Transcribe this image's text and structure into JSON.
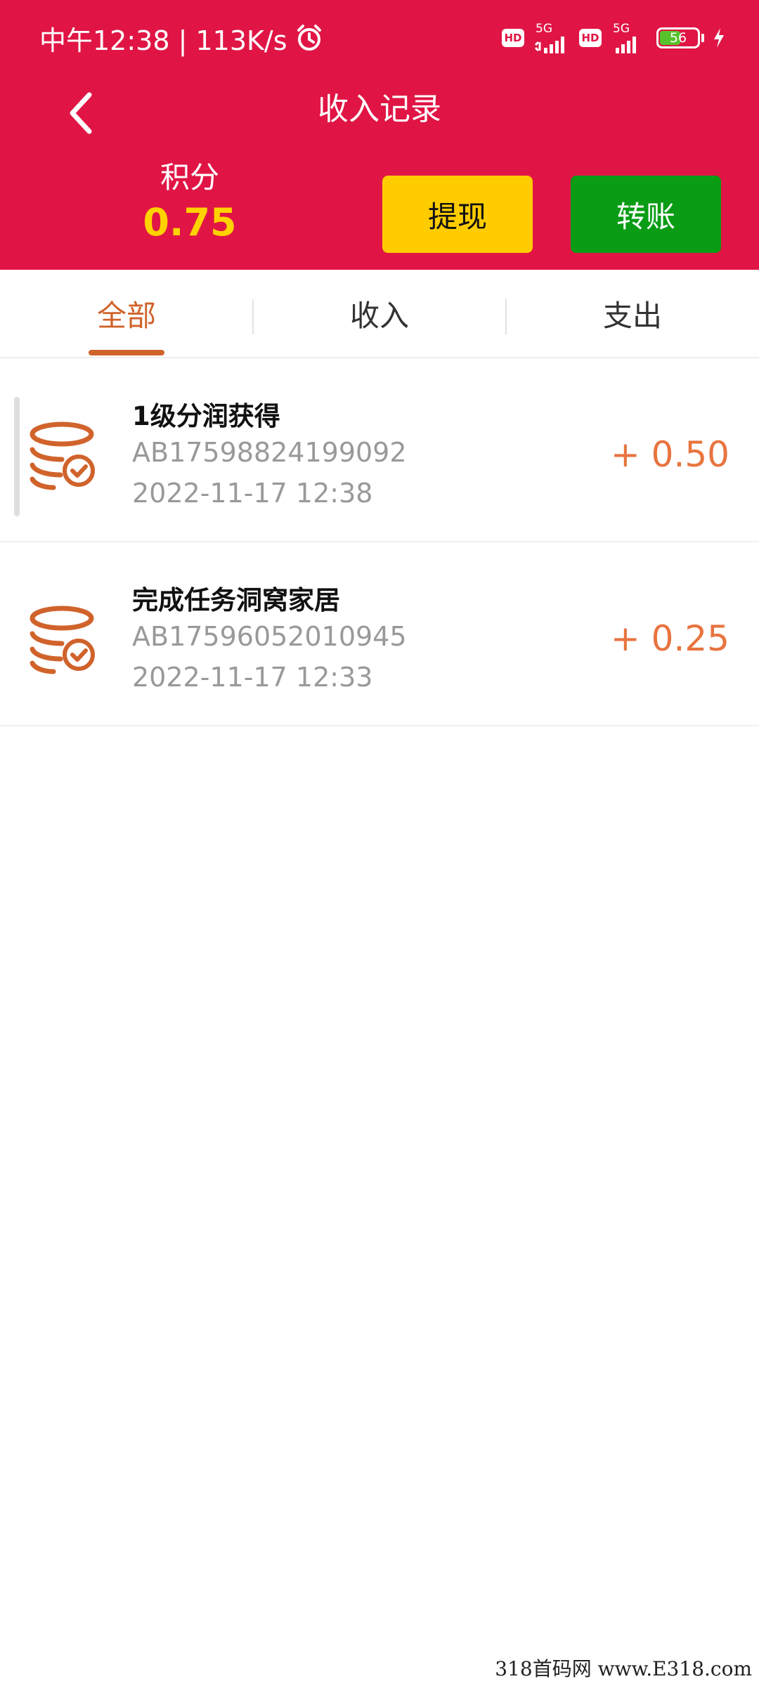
{
  "status_bar": {
    "time_speed": "中午12:38 | 113K/s",
    "hd_label": "HD",
    "network_label": "5G",
    "battery_level": "56",
    "battery_fraction": 0.56,
    "icons": [
      "alarm-clock-icon",
      "signal-icon",
      "battery-icon",
      "charging-icon"
    ]
  },
  "nav": {
    "title": "收入记录",
    "back_icon": "chevron-left-icon"
  },
  "summary": {
    "points_label": "积分",
    "points_value": "0.75",
    "withdraw_label": "提现",
    "transfer_label": "转账"
  },
  "tabs": [
    {
      "label": "全部",
      "active": true
    },
    {
      "label": "收入",
      "active": false
    },
    {
      "label": "支出",
      "active": false
    }
  ],
  "records": [
    {
      "title": "1级分润获得",
      "order_no": "AB17598824199092",
      "time": "2022-11-17 12:38",
      "amount": "+ 0.50",
      "icon": "coin-stack-check-icon"
    },
    {
      "title": "完成任务洞窝家居",
      "order_no": "AB17596052010945",
      "time": "2022-11-17 12:33",
      "amount": "+ 0.25",
      "icon": "coin-stack-check-icon"
    }
  ],
  "watermark": "318首码网 www.E318.com",
  "colors": {
    "header_bg": "#e01545",
    "points_value": "#ffd200",
    "withdraw_bg": "#ffcc00",
    "transfer_bg": "#0a9c15",
    "accent": "#d0632b",
    "amount": "#e8743f"
  }
}
